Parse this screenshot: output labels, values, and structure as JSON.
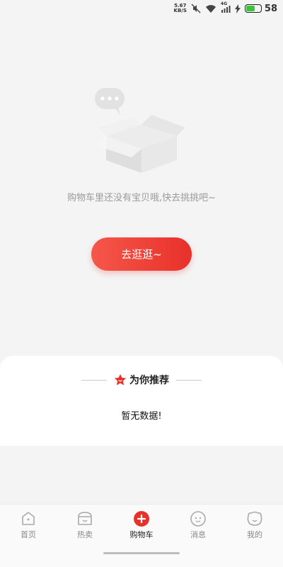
{
  "status_bar": {
    "speed_value": "5.67",
    "speed_unit": "KB/S",
    "network_type": "4G",
    "battery_level": "58",
    "icons": [
      "mute-icon",
      "wifi-icon",
      "signal-icon",
      "charging-icon",
      "battery-icon"
    ]
  },
  "empty_state": {
    "message": "购物车里还没有宝贝哦,快去挑挑吧~",
    "button_label": "去逛逛~",
    "icon": "empty-box-icon"
  },
  "recommend": {
    "title": "为你推荐",
    "empty_text": "暂无数据!",
    "icon": "recommend-badge-icon"
  },
  "tabs": [
    {
      "label": "首页",
      "icon": "home-icon",
      "active": false
    },
    {
      "label": "热卖",
      "icon": "shop-icon",
      "active": false
    },
    {
      "label": "购物车",
      "icon": "cart-plus-icon",
      "active": true
    },
    {
      "label": "消息",
      "icon": "message-icon",
      "active": false
    },
    {
      "label": "我的",
      "icon": "profile-icon",
      "active": false
    }
  ],
  "colors": {
    "accent": "#e8312b",
    "background": "#f4f4f4",
    "text_muted": "#9a9a9a"
  }
}
